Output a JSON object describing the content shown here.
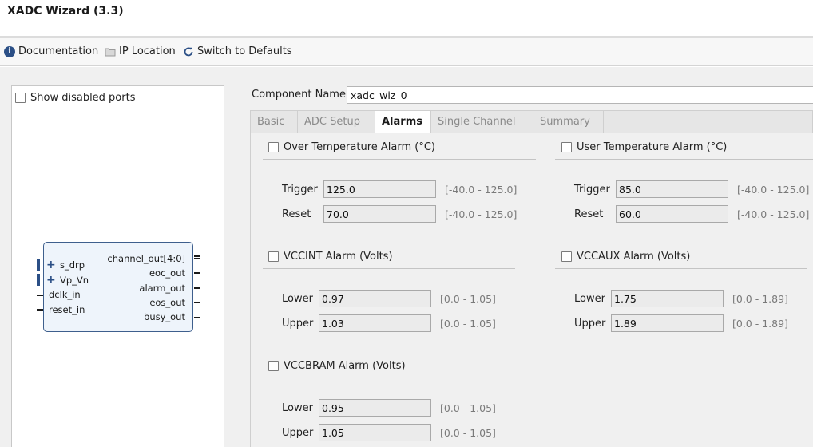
{
  "window": {
    "title": "XADC Wizard (3.3)"
  },
  "toolbar": {
    "documentation": "Documentation",
    "ip_location": "IP Location",
    "switch_defaults": "Switch to Defaults"
  },
  "left_panel": {
    "show_disabled_ports": "Show disabled ports",
    "ports_left": [
      "s_drp",
      "Vp_Vn",
      "dclk_in",
      "reset_in"
    ],
    "ports_right": [
      "channel_out[4:0]",
      "eoc_out",
      "alarm_out",
      "eos_out",
      "busy_out"
    ]
  },
  "component": {
    "label": "Component Name",
    "value": "xadc_wiz_0"
  },
  "tabs": [
    "Basic",
    "ADC Setup",
    "Alarms",
    "Single Channel",
    "Summary"
  ],
  "active_tab": "Alarms",
  "alarms": {
    "over_temp": {
      "title": "Over Temperature Alarm (°C)",
      "field1_label": "Trigger",
      "field1_value": "125.0",
      "field1_range": "[-40.0 - 125.0]",
      "field2_label": "Reset",
      "field2_value": "70.0",
      "field2_range": "[-40.0 - 125.0]"
    },
    "user_temp": {
      "title": "User Temperature Alarm (°C)",
      "field1_label": "Trigger",
      "field1_value": "85.0",
      "field1_range": "[-40.0 - 125.0]",
      "field2_label": "Reset",
      "field2_value": "60.0",
      "field2_range": "[-40.0 - 125.0]"
    },
    "vccint": {
      "title": "VCCINT Alarm (Volts)",
      "field1_label": "Lower",
      "field1_value": "0.97",
      "field1_range": "[0.0 - 1.05]",
      "field2_label": "Upper",
      "field2_value": "1.03",
      "field2_range": "[0.0 - 1.05]"
    },
    "vccaux": {
      "title": "VCCAUX Alarm (Volts)",
      "field1_label": "Lower",
      "field1_value": "1.75",
      "field1_range": "[0.0 - 1.89]",
      "field2_label": "Upper",
      "field2_value": "1.89",
      "field2_range": "[0.0 - 1.89]"
    },
    "vccbram": {
      "title": "VCCBRAM Alarm (Volts)",
      "field1_label": "Lower",
      "field1_value": "0.95",
      "field1_range": "[0.0 - 1.05]",
      "field2_label": "Upper",
      "field2_value": "1.05",
      "field2_range": "[0.0 - 1.05]"
    }
  },
  "colors": {
    "accent": "#2b4f86",
    "block_fill": "#eef4fb"
  },
  "icons": {
    "documentation": "info-icon",
    "ip_location": "folder-icon",
    "switch_defaults": "refresh-icon"
  }
}
